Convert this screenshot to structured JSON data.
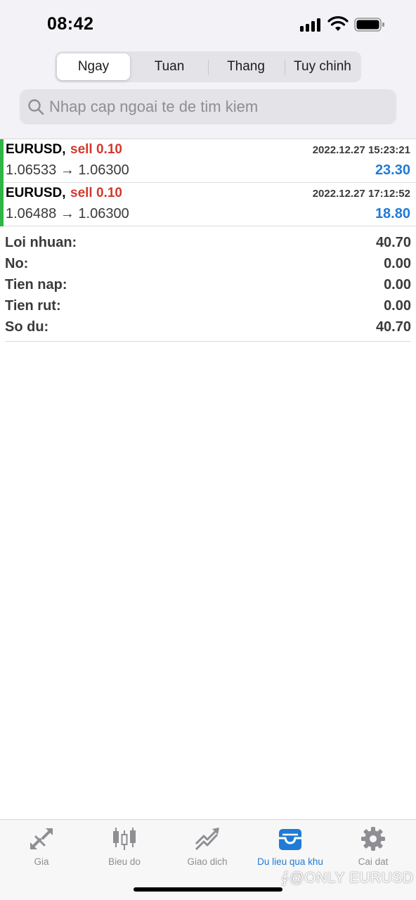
{
  "status": {
    "time": "08:42"
  },
  "segments": [
    {
      "label": "Ngay",
      "active": true
    },
    {
      "label": "Tuan",
      "active": false
    },
    {
      "label": "Thang",
      "active": false
    },
    {
      "label": "Tuy chinh",
      "active": false
    }
  ],
  "search": {
    "placeholder": "Nhap cap ngoai te de tim kiem",
    "value": ""
  },
  "trades": [
    {
      "symbol": "EURUSD,",
      "side": "sell 0.10",
      "time": "2022.12.27 15:23:21",
      "prices": "1.06533 → 1.06300",
      "profit": "23.30"
    },
    {
      "symbol": "EURUSD,",
      "side": "sell 0.10",
      "time": "2022.12.27 17:12:52",
      "prices": "1.06488 → 1.06300",
      "profit": "18.80"
    }
  ],
  "summary": [
    {
      "label": "Loi nhuan:",
      "value": "40.70"
    },
    {
      "label": "No:",
      "value": "0.00"
    },
    {
      "label": "Tien nap:",
      "value": "0.00"
    },
    {
      "label": "Tien rut:",
      "value": "0.00"
    },
    {
      "label": "So du:",
      "value": "40.70"
    }
  ],
  "tabs": [
    {
      "label": "Gia",
      "icon": "quotes-arrows-icon",
      "active": false
    },
    {
      "label": "Bieu do",
      "icon": "candlestick-chart-icon",
      "active": false
    },
    {
      "label": "Giao dich",
      "icon": "trade-trend-icon",
      "active": false
    },
    {
      "label": "Du lieu qua khu",
      "icon": "history-inbox-icon",
      "active": true
    },
    {
      "label": "Cai dat",
      "icon": "gear-icon",
      "active": false
    }
  ],
  "watermark": "@ONLY EURUSD",
  "colors": {
    "accent": "#1f7bd4",
    "sell": "#d2392d",
    "position_bar": "#2fb544",
    "inactive": "#8e8e93"
  }
}
